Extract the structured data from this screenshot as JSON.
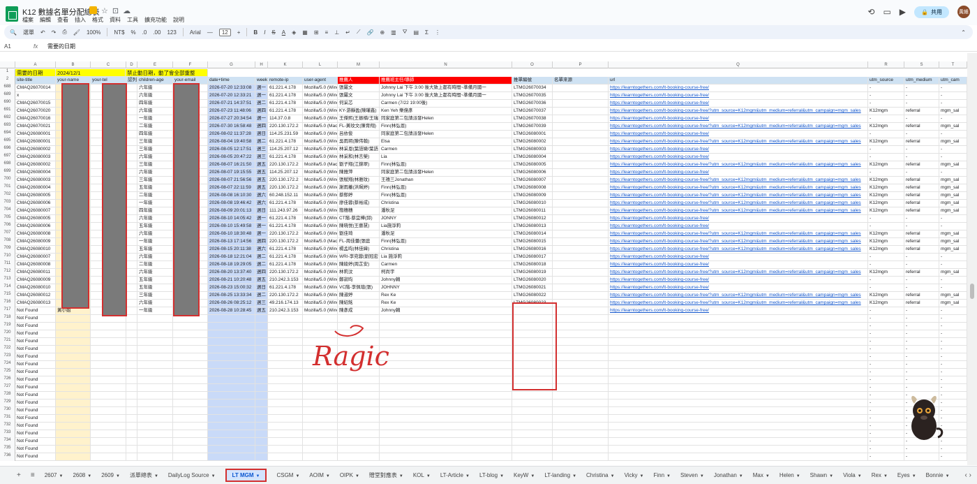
{
  "doc": {
    "title": "K12 數據名單分配總表",
    "menus": [
      "檔案",
      "編輯",
      "查看",
      "插入",
      "格式",
      "資料",
      "工具",
      "擴充功能",
      "說明"
    ]
  },
  "top": {
    "share_label": "共用",
    "avatar_text": "黃維"
  },
  "toolbar": {
    "search": "選單",
    "zoom": "100%",
    "ntd": "NT$",
    "pct": "%",
    "dec0": ".0",
    "dec00": ".00",
    "num123": "123",
    "font": "Arial",
    "minus": "—",
    "size": "12",
    "plus": "+"
  },
  "formula": {
    "cell": "A1",
    "fx": "fx",
    "value": "需要的日期"
  },
  "columns": [
    "A",
    "B",
    "C",
    "D",
    "E",
    "F",
    "G",
    "H",
    "K",
    "L",
    "M",
    "N",
    "O",
    "P",
    "Q",
    "R",
    "S",
    "T"
  ],
  "row1": {
    "a": "需要的日期",
    "b": "2024/12/1",
    "c": "禁止動日期，動了會全部重整"
  },
  "row2": [
    "site-title",
    "your-name",
    "your-tel",
    "認列",
    "children-age",
    "your-email",
    "date+time",
    "week",
    "remote-ip",
    "user-agent",
    "推薦人",
    "推薦班主任/導師",
    "推單編號",
    "名單來源",
    "url",
    "utm_source",
    "utm_medium",
    "utm_cam"
  ],
  "rows": [
    {
      "n": "688",
      "a": "CMAQ26070014",
      "e": "六年級",
      "g": "2026-07-20 12:33:08",
      "h": "週一",
      "k": "61.221.4.178",
      "l": "Mozilla/5.0 (Wind",
      "m": "張屬文",
      "nn": "Johnny Lai 下午 3:00 後大致上都有時間~準備月國一",
      "o": "LTMG26070034",
      "q": "https://learntogethers.com/lt-booking-course-free/",
      "r": "-",
      "s": "-",
      "t": "-"
    },
    {
      "n": "689",
      "a": "x",
      "e": "六年級",
      "g": "2026-07-20 12:33:21",
      "h": "週一",
      "k": "61.221.4.178",
      "l": "Mozilla/5.0 (Wind",
      "m": "張屬文",
      "nn": "Johnny Lai 下午 3:00 後大致上都有時間~準備月國一",
      "o": "LTMG26070035",
      "q": "https://learntogethers.com/lt-booking-course-free/",
      "r": "-",
      "s": "-",
      "t": "-"
    },
    {
      "n": "690",
      "a": "CMAQ26070015",
      "e": "四年級",
      "g": "2026-07-21 14:37:51",
      "h": "週二",
      "k": "61.221.4.178",
      "l": "Mozilla/5.0 (Wind",
      "m": "何采芯",
      "nn": "Carmen (7/22 19:00後)",
      "o": "LTMG26070036",
      "q": "https://learntogethers.com/lt-booking-course-free/",
      "r": "-",
      "s": "-",
      "t": "-"
    },
    {
      "n": "691",
      "a": "CMAQ26070020",
      "e": "六年級",
      "g": "2026-07-23 11:48:06",
      "h": "週四",
      "k": "61.221.4.178",
      "l": "Mozilla/5.0 (Wind",
      "m": "KY-游靜盈(陳瓘鑫)",
      "nn": "Ken Yeh 樂億彥",
      "o": "LTMG26070037",
      "q": "https://learntogethers.com/lt-booking-course-free/?utm_source=K12mgm&utm_medium=referral&utm_campaign=mgm_sales",
      "r": "K12mgm",
      "s": "referral",
      "t": "mgm_sal"
    },
    {
      "n": "692",
      "a": "CMAQ26070016",
      "e": "一年級",
      "g": "2026-07-27 20:34:54",
      "h": "週一",
      "k": "114.37.0.8",
      "l": "Mozilla/5.0 (Wind",
      "m": "王傑熙(王振楠/王瑞",
      "nn": "同家庭第二包請派發Helen",
      "o": "LTMG26070038",
      "q": "https://learntogethers.com/lt-booking-course-free/",
      "r": "-",
      "s": "-",
      "t": "-"
    },
    {
      "n": "693",
      "a": "CMAQ26070021",
      "e": "二年級",
      "g": "2026-07-30 16:58:48",
      "h": "週四",
      "k": "220.130.172.2",
      "l": "Mozilla/5.0 (Mac",
      "m": "FL-黃玟文(陳育翔)",
      "nn": "Finn(林弘恩)",
      "o": "LTMG26070039",
      "q": "https://learntogethers.com/lt-booking-course-free/?utm_source=K12mgm&utm_medium=referral&utm_campaign=mgm_sales",
      "r": "K12mgm",
      "s": "referral",
      "t": "mgm_sal"
    },
    {
      "n": "694",
      "a": "CMAQ26080001",
      "e": "四年級",
      "g": "2026-08-02 11:37:28",
      "h": "週日",
      "k": "114.25.231.59",
      "l": "Mozilla/5.0 (Wind",
      "m": "呂依俊",
      "nn": "同家庭第二包請派發Helen",
      "o": "LTMG26080001",
      "q": "https://learntogethers.com/lt-booking-course-free/",
      "r": "-",
      "s": "-",
      "t": "-"
    },
    {
      "n": "695",
      "a": "CMAQ26080001",
      "e": "三年級",
      "g": "2026-08-04 19:40:58",
      "h": "週二",
      "k": "61.221.4.178",
      "l": "Mozilla/5.0 (Wind",
      "m": "吳雨玥(陳伟翰)",
      "nn": "Elsa",
      "o": "LTMG26080002",
      "q": "https://learntogethers.com/lt-booking-course-free/?utm_source=K12mgm&utm_medium=referral&utm_campaign=mgm_sales",
      "r": "K12mgm",
      "s": "referral",
      "t": "mgm_sal"
    },
    {
      "n": "696",
      "a": "CMAQ26080002",
      "e": "三年級",
      "g": "2026-08-05 12:17:51",
      "h": "週三",
      "k": "114.25.207.12",
      "l": "Mozilla/5.0 (Wind",
      "m": "林采恩(葉語婕/葉語",
      "nn": "Carmen",
      "o": "LTMG26080003",
      "q": "https://learntogethers.com/lt-booking-course-free/",
      "r": "-",
      "s": "-",
      "t": "-"
    },
    {
      "n": "697",
      "a": "CMAQ26080003",
      "e": "六年級",
      "g": "2026-08-05 20:47:22",
      "h": "週三",
      "k": "61.221.4.178",
      "l": "Mozilla/5.0 (Wind",
      "m": "林采和(林言榮)",
      "nn": "Lia",
      "o": "LTMG26080004",
      "q": "https://learntogethers.com/lt-booking-course-free/",
      "r": "-",
      "s": "-",
      "t": "-"
    },
    {
      "n": "698",
      "a": "CMAQ26080002",
      "e": "三年級",
      "g": "2026-08-07 16:21:50",
      "h": "週五",
      "k": "220.130.172.2",
      "l": "Mozilla/5.0 (Mac",
      "m": "劉子翔(江錦翠)",
      "nn": "Finn(林弘恩)",
      "o": "LTMG26080005",
      "q": "https://learntogethers.com/lt-booking-course-free/?utm_source=K12mgm&utm_medium=referral&utm_campaign=mgm_sales",
      "r": "K12mgm",
      "s": "referral",
      "t": "mgm_sal"
    },
    {
      "n": "699",
      "a": "CMAQ26080004",
      "e": "六年級",
      "g": "2026-08-07 19:15:55",
      "h": "週五",
      "k": "114.25.207.12",
      "l": "Mozilla/5.0 (Wind",
      "m": "陳雅萍",
      "nn": "同家庭第二包請派發Helen",
      "o": "LTMG26080006",
      "q": "https://learntogethers.com/lt-booking-course-free/",
      "r": "-",
      "s": "-",
      "t": "-"
    },
    {
      "n": "700",
      "a": "CMAQ26080003",
      "e": "三年級",
      "g": "2026-08-07 21:56:56",
      "h": "週五",
      "k": "220.130.172.2",
      "l": "Mozilla/5.0 (Wind",
      "m": "張賦翔(林雅玟)",
      "nn": "王禧三Jonathan",
      "o": "LTMG26080007",
      "q": "https://learntogethers.com/lt-booking-course-free/?utm_source=K12mgm&utm_medium=referral&utm_campaign=mgm_sales",
      "r": "K12mgm",
      "s": "referral",
      "t": "mgm_sal"
    },
    {
      "n": "701",
      "a": "CMAQ26080004",
      "e": "五年級",
      "g": "2026-08-07 22:11:59",
      "h": "週五",
      "k": "220.130.172.2",
      "l": "Mozilla/5.0 (Wind",
      "m": "謝雨蓁(洪珮婷)",
      "nn": "Finn(林弘恩)",
      "o": "LTMG26080008",
      "q": "https://learntogethers.com/lt-booking-course-free/?utm_source=K12mgm&utm_medium=referral&utm_campaign=mgm_sales",
      "r": "K12mgm",
      "s": "referral",
      "t": "mgm_sal"
    },
    {
      "n": "702",
      "a": "CMAQ26080005",
      "e": "二年級",
      "g": "2026-08-08 16:10:30",
      "h": "週六",
      "k": "60.248.152.11",
      "l": "Mozilla/5.0 (Wind",
      "m": "蔡郁婷",
      "nn": "Finn(林弘恩)",
      "o": "LTMG26080009",
      "q": "https://learntogethers.com/lt-booking-course-free/?utm_source=K12mgm&utm_medium=referral&utm_campaign=mgm_sales",
      "r": "K12mgm",
      "s": "referral",
      "t": "mgm_sal"
    },
    {
      "n": "703",
      "a": "CMAQ26080006",
      "e": "一年級",
      "g": "2026-08-08 19:46:42",
      "h": "週六",
      "k": "61.221.4.178",
      "l": "Mozilla/5.0 (Wind",
      "m": "廖佳蓉(蔡裕成)",
      "nn": "Christina",
      "o": "LTMG26080010",
      "q": "https://learntogethers.com/lt-booking-course-free/?utm_source=K12mgm&utm_medium=referral&utm_campaign=mgm_sales",
      "r": "K12mgm",
      "s": "referral",
      "t": "mgm_sal"
    },
    {
      "n": "704",
      "a": "CMAQ26080007",
      "e": "四年級",
      "g": "2026-08-09 20:01:13",
      "h": "週日",
      "k": "111.243.97.26",
      "l": "Mozilla/5.0 (Wind",
      "m": "簡穗穗",
      "nn": "潘秋足",
      "o": "LTMG26080011",
      "q": "https://learntogethers.com/lt-booking-course-free/?utm_source=K12mgm&utm_medium=referral&utm_campaign=mgm_sales",
      "r": "K12mgm",
      "s": "referral",
      "t": "mgm_sal"
    },
    {
      "n": "705",
      "a": "CMAQ26080005",
      "e": "六年級",
      "g": "2026-08-10 14:05:42",
      "h": "週一",
      "k": "61.221.4.178",
      "l": "Mozilla/5.0 (Wind",
      "m": "CT階-蔡宜樺(邱)",
      "nn": "JONNY",
      "o": "LTMG26080012",
      "q": "https://learntogethers.com/lt-booking-course-free/",
      "r": "-",
      "s": "-",
      "t": "-"
    },
    {
      "n": "706",
      "a": "CMAQ26080006",
      "e": "五年級",
      "g": "2026-08-10 15:49:58",
      "h": "週一",
      "k": "61.221.4.178",
      "l": "Mozilla/5.0 (Wind",
      "m": "陳晓悦(王藝慧)",
      "nn": "Lia施淨莉",
      "o": "LTMG26080013",
      "q": "https://learntogethers.com/lt-booking-course-free/",
      "r": "-",
      "s": "-",
      "t": "-"
    },
    {
      "n": "707",
      "a": "CMAQ26080008",
      "e": "六年級",
      "g": "2026-08-10 18:30:48",
      "h": "週一",
      "k": "220.130.172.2",
      "l": "Mozilla/5.0 (Wind",
      "m": "劉佳琦",
      "nn": "潘秋足",
      "o": "LTMG26080014",
      "q": "https://learntogethers.com/lt-booking-course-free/?utm_source=K12mgm&utm_medium=referral&utm_campaign=mgm_sales",
      "r": "K12mgm",
      "s": "referral",
      "t": "mgm_sal"
    },
    {
      "n": "708",
      "a": "CMAQ26080009",
      "e": "一年級",
      "g": "2026-08-13 17:14:56",
      "h": "週四",
      "k": "220.130.172.2",
      "l": "Mozilla/5.0 (Mac",
      "m": "FL-周佳蕾(張庭",
      "nn": "Finn(林弘恩)",
      "o": "LTMG26080015",
      "q": "https://learntogethers.com/lt-booking-course-free/?utm_source=K12mgm&utm_medium=referral&utm_campaign=mgm_sales",
      "r": "K12mgm",
      "s": "referral",
      "t": "mgm_sal"
    },
    {
      "n": "709",
      "a": "CMAQ26080010",
      "e": "五年級",
      "g": "2026-08-15 20:11:38",
      "h": "週六",
      "k": "61.221.4.178",
      "l": "Mozilla/5.0 (Wind",
      "m": "楊孟昀(林佳緯)",
      "nn": "Christina",
      "o": "LTMG26080016",
      "q": "https://learntogethers.com/lt-booking-course-free/?utm_source=K12mgm&utm_medium=referral&utm_campaign=mgm_sales",
      "r": "K12mgm",
      "s": "referral",
      "t": "mgm_sal"
    },
    {
      "n": "710",
      "a": "CMAQ26080007",
      "e": "六年級",
      "g": "2026-08-18 12:21:04",
      "h": "週二",
      "k": "61.221.4.178",
      "l": "Mozilla/5.0 (Wind",
      "m": "WRI-李宛蓉(劉冠宏",
      "nn": "Lia 施淨莉",
      "o": "LTMG26080017",
      "q": "https://learntogethers.com/lt-booking-course-free/",
      "r": "-",
      "s": "-",
      "t": "-"
    },
    {
      "n": "711",
      "a": "CMAQ26080008",
      "e": "二年級",
      "g": "2026-08-18 19:29:05",
      "h": "週二",
      "k": "61.221.4.178",
      "l": "Mozilla/5.0 (Wind",
      "m": "陳綾婷(周芷安)",
      "nn": "Carmen",
      "o": "LTMG26080018",
      "q": "https://learntogethers.com/lt-booking-course-free/",
      "r": "-",
      "s": "-",
      "t": "-"
    },
    {
      "n": "712",
      "a": "CMAQ26080011",
      "e": "六年級",
      "g": "2026-08-20 13:37:40",
      "h": "週四",
      "k": "220.130.172.2",
      "l": "Mozilla/5.0 (Wind",
      "m": "林莉汶",
      "nn": "柯尚宇",
      "o": "LTMG26080019",
      "q": "https://learntogethers.com/lt-booking-course-free/?utm_source=K12mgm&utm_medium=referral&utm_campaign=mgm_sales",
      "r": "K12mgm",
      "s": "referral",
      "t": "mgm_sal"
    },
    {
      "n": "713",
      "a": "CMAQ26080009",
      "e": "五年級",
      "g": "2026-08-21 10:20:48",
      "h": "週五",
      "k": "210.242.3.153",
      "l": "Mozilla/5.0 (Wind",
      "m": "鄭寂昀",
      "nn": "Johnny賴",
      "o": "LTMG26080020",
      "q": "https://learntogethers.com/lt-booking-course-free/",
      "r": "-",
      "s": "-",
      "t": "-"
    },
    {
      "n": "714",
      "a": "CMAQ26080010",
      "e": "五年級",
      "g": "2026-08-23 15:00:32",
      "h": "週日",
      "k": "61.221.4.178",
      "l": "Mozilla/5.0 (Wind",
      "m": "VC階-李佩瑄(張)",
      "nn": "JOHNNY",
      "o": "LTMG26080021",
      "q": "https://learntogethers.com/lt-booking-course-free/",
      "r": "-",
      "s": "-",
      "t": "-"
    },
    {
      "n": "715",
      "a": "CMAQ26080012",
      "e": "三年級",
      "g": "2026-08-25 13:33:34",
      "h": "週二",
      "k": "220.130.172.2",
      "l": "Mozilla/5.0 (Wind",
      "m": "陳淑婷",
      "nn": "Rex Ke",
      "o": "LTMG26080022",
      "q": "https://learntogethers.com/lt-booking-course-free/?utm_source=K12mgm&utm_medium=referral&utm_campaign=mgm_sales",
      "r": "K12mgm",
      "s": "referral",
      "t": "mgm_sal"
    },
    {
      "n": "716",
      "a": "CMAQ26080013",
      "e": "六年級",
      "g": "2026-08-26 08:25:12",
      "h": "週三",
      "k": "49.216.174.13",
      "l": "Mozilla/5.0 (Wind",
      "m": "陳紹銘",
      "nn": "Rex Ke",
      "o": "LTMG26080023",
      "q": "https://learntogethers.com/lt-booking-course-free/?utm_source=K12mgm&utm_medium=referral&utm_campaign=mgm_sales",
      "r": "K12mgm",
      "s": "referral",
      "t": "mgm_sal"
    },
    {
      "n": "717",
      "a": "Not Found",
      "b": "黃小姐",
      "e": "一年級",
      "g": "2026-08-28 10:28:45",
      "h": "週五",
      "k": "210.242.3.153",
      "l": "Mozilla/5.0 (Wind",
      "m": "陳彥成",
      "nn": "Johnny賴",
      "o": "",
      "q": "https://learntogethers.com/lt-booking-course-free/",
      "r": "-",
      "s": "-",
      "t": "-"
    }
  ],
  "nf_label": "Not Found",
  "dash": "-",
  "nf_first": 718,
  "nf_last": 736,
  "annotation": "Ragic",
  "tabs": [
    "2607",
    "2608",
    "2609",
    "派單總表",
    "DailyLog Source",
    "LT MGM",
    "CSGM",
    "AOIM",
    "OIPK",
    "贈堂對應表",
    "KOL",
    "LT-Article",
    "LT-blog",
    "KeyW",
    "LT-landing",
    "Christina",
    "Vicky",
    "Finn",
    "Steven",
    "Jonathan",
    "Max",
    "Helen",
    "Shawn",
    "Viola",
    "Rex",
    "Eyes",
    "Bonnie"
  ],
  "active_tab": "LT MGM"
}
